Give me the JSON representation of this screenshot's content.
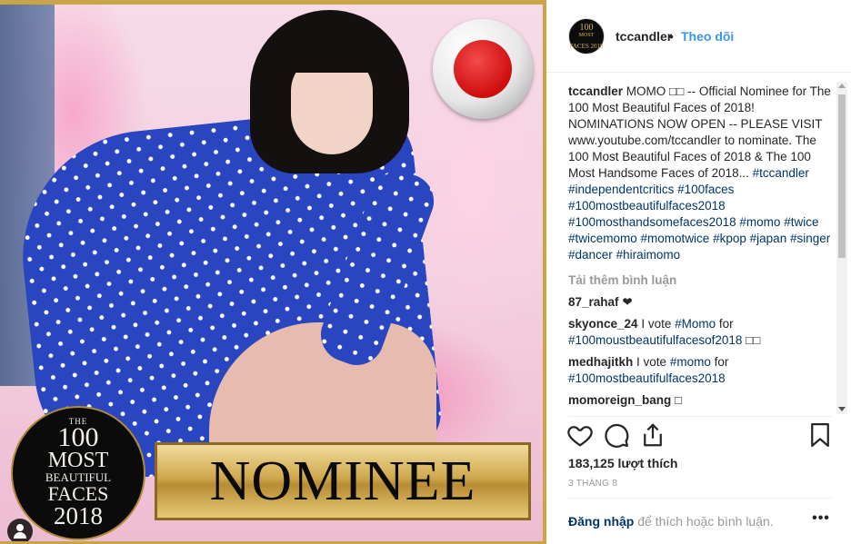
{
  "photo": {
    "badge": {
      "line1": "THE",
      "line2": "100",
      "line3": "MOST",
      "line4": "BEAUTIFUL",
      "line5": "FACES",
      "line6": "2018"
    },
    "nominee_label": "NOMINEE",
    "flag_icon": "japan-flag-icon",
    "user_tag_icon": "person-icon"
  },
  "header": {
    "avatar": {
      "line1": "100",
      "line2": "MOST",
      "line3": "FACES 2018"
    },
    "username": "tccandler",
    "separator": "•",
    "follow_label": "Theo dõi"
  },
  "caption": {
    "username": "tccandler",
    "text": "MOMO □□ -- Official Nominee for The 100 Most Beautiful Faces of 2018! NOMINATIONS NOW OPEN -- PLEASE VISIT www.youtube.com/tccandler to nominate. The 100 Most Beautiful Faces of 2018 & The 100 Most Handsome Faces of 2018... ",
    "hashtags": [
      "#tccandler",
      "#independentcritics",
      "#100faces",
      "#100mostbeautifulfaces2018",
      "#100mosthandsomefaces2018",
      "#momo",
      "#twice",
      "#twicemomo",
      "#momotwice",
      "#kpop",
      "#japan",
      "#singer",
      "#dancer",
      "#hiraimomo"
    ]
  },
  "load_more": "Tải thêm bình luận",
  "comments": [
    {
      "username": "87_rahaf",
      "text": "❤",
      "tag": "",
      "after": ""
    },
    {
      "username": "skyonce_24",
      "text": "I vote ",
      "tag": "#Momo",
      "after": " for",
      "tag2": "#100moustbeautifulfacesof2018",
      "after2": " □□"
    },
    {
      "username": "medhajitkh",
      "text": "I vote ",
      "tag": "#momo",
      "after": " for",
      "tag2": "#100mostbeautifulfaces2018",
      "after2": ""
    },
    {
      "username": "momoreign_bang",
      "text": "□",
      "tag": "",
      "after": ""
    }
  ],
  "actions": {
    "like_icon": "heart-icon",
    "comment_icon": "comment-icon",
    "share_icon": "share-icon",
    "save_icon": "bookmark-icon"
  },
  "likes": "183,125 lượt thích",
  "date": "3 THÁNG 8",
  "footer": {
    "login_label": "Đăng nhập",
    "rest_text": " để thích hoặc bình luận.",
    "options_label": "•••"
  },
  "colors": {
    "link": "#003569",
    "follow": "#3897f0",
    "muted": "#999999",
    "frame_gold": "#c9a449"
  }
}
